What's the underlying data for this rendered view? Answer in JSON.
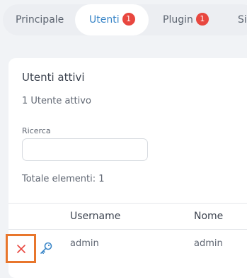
{
  "tabs": [
    {
      "label": "Principale"
    },
    {
      "label": "Utenti",
      "badge": "1"
    },
    {
      "label": "Plugin",
      "badge": "1"
    },
    {
      "label": "Sic"
    }
  ],
  "card": {
    "title": "Utenti attivi",
    "subtitle": "1 Utente attivo",
    "search_label": "Ricerca",
    "search_value": "",
    "total": "Totale elementi: 1"
  },
  "table": {
    "columns": [
      "Username",
      "Nome"
    ],
    "rows": [
      {
        "username": "admin",
        "nome": "admin"
      }
    ]
  },
  "colors": {
    "accent": "#3a86c8",
    "badge": "#e8473f",
    "delete": "#e8473f",
    "highlight": "#e8762c"
  },
  "icons": {
    "delete": "close-icon",
    "key": "key-icon"
  }
}
